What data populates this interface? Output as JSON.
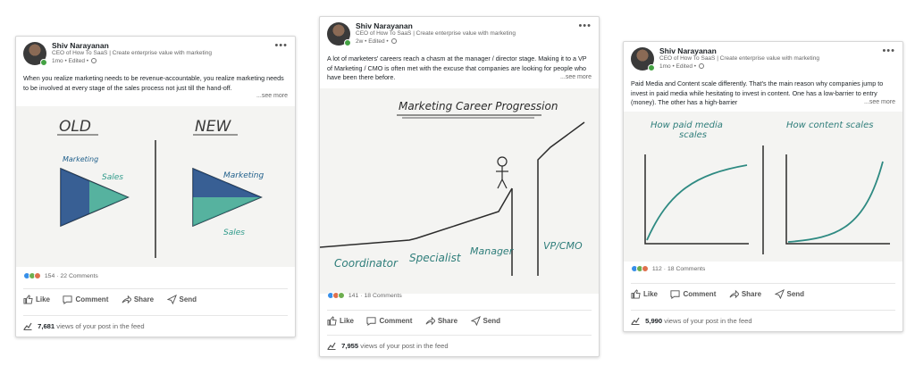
{
  "author": {
    "name": "Shiv Narayanan",
    "headline": "CEO of How To SaaS | Create enterprise value with marketing"
  },
  "more_label": "•••",
  "see_more": "...see more",
  "actions": {
    "like": "Like",
    "comment": "Comment",
    "share": "Share",
    "send": "Send"
  },
  "views_suffix": "views of your post in the feed",
  "colors": {
    "online": "#44a243",
    "like": "#378fe9",
    "celebrate": "#6dae4f",
    "love": "#df704d",
    "ink": "#1f5f8b",
    "teal": "#2e9a8a"
  },
  "posts": [
    {
      "meta": "1mo • Edited •",
      "text": "When you realize marketing needs to be revenue-accountable, you realize marketing needs to be involved at every stage of the sales process not just till the hand-off.",
      "reactions": "154",
      "comments": "22 Comments",
      "views": "7,681",
      "figure": {
        "left_title": "OLD",
        "right_title": "NEW",
        "marketing": "Marketing",
        "sales": "Sales"
      }
    },
    {
      "meta": "2w • Edited •",
      "text": "A lot of marketers' careers reach a chasm at the manager / director stage. Making it to a VP of Marketing / CMO is often met with the excuse that companies are looking for people who have been there before.",
      "reactions": "141",
      "comments": "18 Comments",
      "views": "7,955",
      "figure": {
        "title": "Marketing Career Progression",
        "coordinator": "Coordinator",
        "specialist": "Specialist",
        "manager": "Manager",
        "vp": "VP/CMO"
      }
    },
    {
      "meta": "1mo • Edited •",
      "text": "Paid Media and Content scale differently. That's the main reason why companies jump to invest in paid media while hesitating to invest in content. One has a low-barrier to entry (money). The other has a high-barrier",
      "reactions": "112",
      "comments": "18 Comments",
      "views": "5,990",
      "figure": {
        "left_title_1": "How paid media",
        "left_title_2": "scales",
        "right_title": "How content scales"
      }
    }
  ]
}
